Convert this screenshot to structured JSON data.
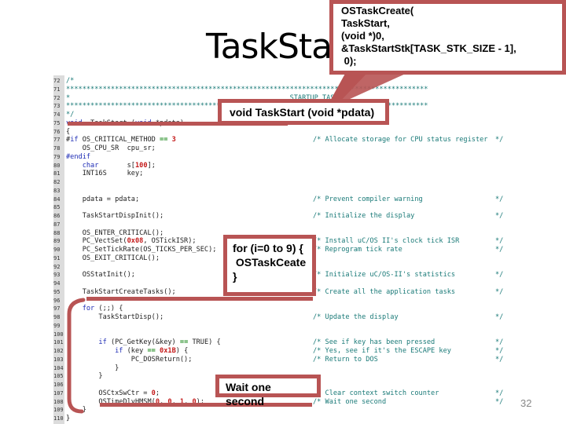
{
  "slide": {
    "title": "TaskStart",
    "page_number": "32",
    "accent_color": "#b85454"
  },
  "callouts": {
    "create_call": [
      "OSTaskCreate(",
      "TaskStart,",
      "(void *)0,",
      "&TaskStartStk[TASK_STK_SIZE - 1],",
      " 0);"
    ],
    "signature": "void TaskStart (void *pdata)",
    "loop": "for (i=0 to 9) {\n OSTaskCeate\n}",
    "wait": "Wait one second"
  },
  "code": {
    "lines": [
      {
        "n": "72",
        "t": "/*",
        "c": "",
        "e": ""
      },
      {
        "n": "71",
        "t": "*****************************************************************************************",
        "c": "",
        "e": ""
      },
      {
        "n": "72",
        "t": "*                                                      STARTUP TASK",
        "c": "",
        "e": ""
      },
      {
        "n": "73",
        "t": "*****************************************************************************************",
        "c": "",
        "e": ""
      },
      {
        "n": "74",
        "t": "*/",
        "c": "",
        "e": ""
      },
      {
        "n": "75",
        "t": "void  TaskStart (void *pdata)",
        "c": "",
        "e": ""
      },
      {
        "n": "76",
        "t": "{",
        "c": "",
        "e": ""
      },
      {
        "n": "77",
        "t": "#if OS_CRITICAL_METHOD == 3",
        "c": "/* Allocate storage for CPU status register",
        "e": "*/"
      },
      {
        "n": "78",
        "t": "    OS_CPU_SR  cpu_sr;",
        "c": "",
        "e": ""
      },
      {
        "n": "79",
        "t": "#endif",
        "c": "",
        "e": ""
      },
      {
        "n": "80",
        "t": "    char       s[100];",
        "c": "",
        "e": ""
      },
      {
        "n": "81",
        "t": "    INT16S     key;",
        "c": "",
        "e": ""
      },
      {
        "n": "82",
        "t": "",
        "c": "",
        "e": ""
      },
      {
        "n": "83",
        "t": "",
        "c": "",
        "e": ""
      },
      {
        "n": "84",
        "t": "    pdata = pdata;",
        "c": "/* Prevent compiler warning",
        "e": "*/"
      },
      {
        "n": "85",
        "t": "",
        "c": "",
        "e": ""
      },
      {
        "n": "86",
        "t": "    TaskStartDispInit();",
        "c": "/* Initialize the display",
        "e": "*/"
      },
      {
        "n": "87",
        "t": "",
        "c": "",
        "e": ""
      },
      {
        "n": "88",
        "t": "    OS_ENTER_CRITICAL();",
        "c": "",
        "e": ""
      },
      {
        "n": "89",
        "t": "    PC_VectSet(0x08, OSTickISR);",
        "c": "/* Install uC/OS II's clock tick ISR",
        "e": "*/"
      },
      {
        "n": "90",
        "t": "    PC_SetTickRate(OS_TICKS_PER_SEC);",
        "c": "/* Reprogram tick rate",
        "e": "*/"
      },
      {
        "n": "91",
        "t": "    OS_EXIT_CRITICAL();",
        "c": "",
        "e": ""
      },
      {
        "n": "92",
        "t": "",
        "c": "",
        "e": ""
      },
      {
        "n": "93",
        "t": "    OSStatInit();",
        "c": "/* Initialize uC/OS-II's statistics",
        "e": "*/"
      },
      {
        "n": "94",
        "t": "",
        "c": "",
        "e": ""
      },
      {
        "n": "95",
        "t": "    TaskStartCreateTasks();",
        "c": "/* Create all the application tasks",
        "e": "*/"
      },
      {
        "n": "96",
        "t": "",
        "c": "",
        "e": ""
      },
      {
        "n": "97",
        "t": "    for (;;) {",
        "c": "",
        "e": ""
      },
      {
        "n": "98",
        "t": "        TaskStartDisp();",
        "c": "/* Update the display",
        "e": "*/"
      },
      {
        "n": "99",
        "t": "",
        "c": "",
        "e": ""
      },
      {
        "n": "100",
        "t": "",
        "c": "",
        "e": ""
      },
      {
        "n": "101",
        "t": "        if (PC_GetKey(&key) == TRUE) {",
        "c": "/* See if key has been pressed",
        "e": "*/"
      },
      {
        "n": "102",
        "t": "            if (key == 0x1B) {",
        "c": "/* Yes, see if it's the ESCAPE key",
        "e": "*/"
      },
      {
        "n": "103",
        "t": "                PC_DOSReturn();",
        "c": "/* Return to DOS",
        "e": "*/"
      },
      {
        "n": "104",
        "t": "            }",
        "c": "",
        "e": ""
      },
      {
        "n": "105",
        "t": "        }",
        "c": "",
        "e": ""
      },
      {
        "n": "106",
        "t": "",
        "c": "",
        "e": ""
      },
      {
        "n": "107",
        "t": "        OSCtxSwCtr = 0;",
        "c": "/* Clear context switch counter",
        "e": "*/"
      },
      {
        "n": "108",
        "t": "        OSTimeDlyHMSM(0, 0, 1, 0);",
        "c": "/* Wait one second",
        "e": "*/"
      },
      {
        "n": "109",
        "t": "    }",
        "c": "",
        "e": ""
      },
      {
        "n": "110",
        "t": "}",
        "c": "",
        "e": ""
      }
    ]
  }
}
